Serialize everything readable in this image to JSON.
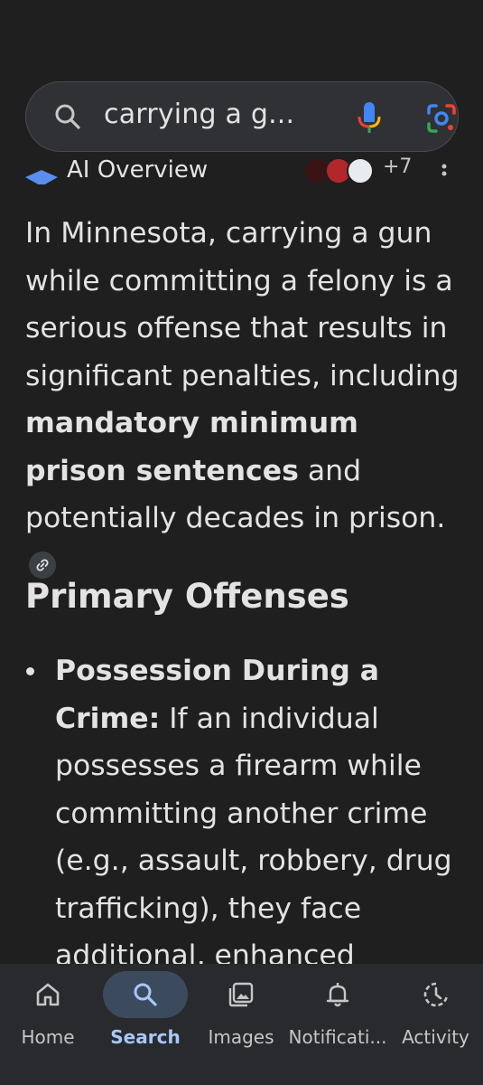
{
  "search": {
    "query": "carrying a g..."
  },
  "overview": {
    "title": "AI Overview",
    "more_sources": "+7",
    "summary": {
      "part1": "In Minnesota, carrying a gun while committing a felony is a serious offense that results in significant penalties, including ",
      "bold": "mandatory minimum prison sentences",
      "part2": " and potentially decades in prison. "
    },
    "section_title": "Primary Offenses",
    "bullets": [
      {
        "label": "Possession During a Crime:",
        "text": " If an individual possesses a firearm while committing another crime (e.g., assault, robbery, drug trafficking), they face additional, enhanced"
      }
    ]
  },
  "nav": {
    "items": [
      {
        "label": "Home",
        "icon": "home-icon"
      },
      {
        "label": "Search",
        "icon": "search-icon"
      },
      {
        "label": "Images",
        "icon": "images-icon"
      },
      {
        "label": "Notificati...",
        "icon": "bell-icon"
      },
      {
        "label": "Activity",
        "icon": "activity-icon"
      }
    ],
    "active": "Search"
  },
  "colors": {
    "background": "#1f1f1f",
    "search_bar": "#303134",
    "nav_active": "#a8c7fa",
    "nav_pill": "#3c4a5e"
  }
}
